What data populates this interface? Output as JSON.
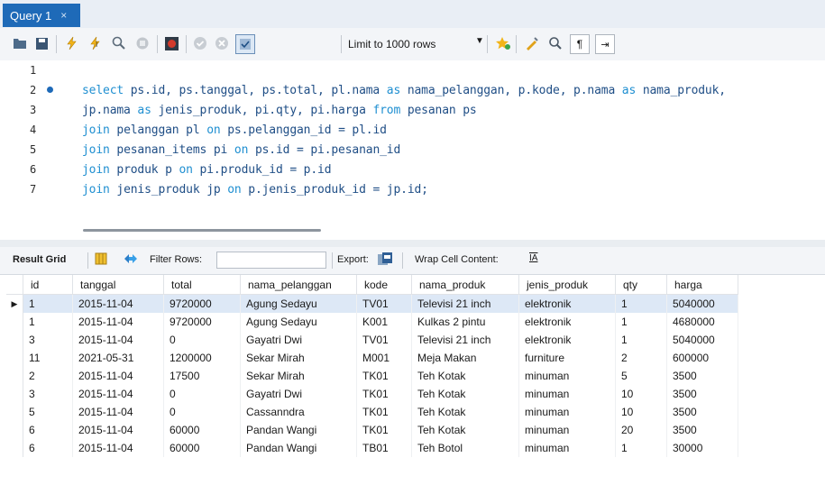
{
  "tab": {
    "label": "Query 1",
    "close": "×"
  },
  "toolbar": {
    "limit_label": "Limit to 1000 rows",
    "icons": [
      "folder-open-icon",
      "save-icon",
      "execute-icon",
      "execute-current-icon",
      "explain-icon",
      "stop-icon",
      "toggle-error-icon",
      "commit-icon",
      "rollback-icon",
      "autocommit-icon",
      "limit-dropdown",
      "bookmark-star-icon",
      "beautify-icon",
      "find-icon",
      "invisible-chars-icon",
      "wrap-icon"
    ]
  },
  "editor": {
    "lines": [
      {
        "n": "1",
        "parts": []
      },
      {
        "n": "2",
        "parts": [
          [
            "kw",
            "select"
          ],
          [
            "t",
            " ps.id, ps.tanggal, ps.total, pl.nama "
          ],
          [
            "kw",
            "as"
          ],
          [
            "t",
            " nama_pelanggan, p.kode, p.nama "
          ],
          [
            "kw",
            "as"
          ],
          [
            "t",
            " nama_produk,"
          ]
        ]
      },
      {
        "n": "3",
        "parts": [
          [
            "t",
            "jp.nama "
          ],
          [
            "kw",
            "as"
          ],
          [
            "t",
            " jenis_produk, pi.qty, pi.harga "
          ],
          [
            "kw",
            "from"
          ],
          [
            "t",
            " pesanan ps"
          ]
        ]
      },
      {
        "n": "4",
        "parts": [
          [
            "kw",
            "join"
          ],
          [
            "t",
            " pelanggan pl "
          ],
          [
            "kw",
            "on"
          ],
          [
            "t",
            " ps.pelanggan_id = pl.id"
          ]
        ]
      },
      {
        "n": "5",
        "parts": [
          [
            "kw",
            "join"
          ],
          [
            "t",
            " pesanan_items pi "
          ],
          [
            "kw",
            "on"
          ],
          [
            "t",
            " ps.id = pi.pesanan_id"
          ]
        ]
      },
      {
        "n": "6",
        "parts": [
          [
            "kw",
            "join"
          ],
          [
            "t",
            " produk p "
          ],
          [
            "kw",
            "on"
          ],
          [
            "t",
            " pi.produk_id = p.id"
          ]
        ]
      },
      {
        "n": "7",
        "parts": [
          [
            "kw",
            "join"
          ],
          [
            "t",
            " jenis_produk jp "
          ],
          [
            "kw",
            "on"
          ],
          [
            "t",
            " p.jenis_produk_id = jp.id;"
          ]
        ]
      }
    ]
  },
  "result_bar": {
    "result_grid": "Result Grid",
    "filter_rows": "Filter Rows:",
    "filter_value": "",
    "export": "Export:",
    "wrap": "Wrap Cell Content:"
  },
  "grid": {
    "columns": [
      "id",
      "tanggal",
      "total",
      "nama_pelanggan",
      "kode",
      "nama_produk",
      "jenis_produk",
      "qty",
      "harga"
    ],
    "rows": [
      [
        "1",
        "2015-11-04",
        "9720000",
        "Agung Sedayu",
        "TV01",
        "Televisi 21 inch",
        "elektronik",
        "1",
        "5040000"
      ],
      [
        "1",
        "2015-11-04",
        "9720000",
        "Agung Sedayu",
        "K001",
        "Kulkas 2 pintu",
        "elektronik",
        "1",
        "4680000"
      ],
      [
        "3",
        "2015-11-04",
        "0",
        "Gayatri Dwi",
        "TV01",
        "Televisi 21 inch",
        "elektronik",
        "1",
        "5040000"
      ],
      [
        "11",
        "2021-05-31",
        "1200000",
        "Sekar Mirah",
        "M001",
        "Meja Makan",
        "furniture",
        "2",
        "600000"
      ],
      [
        "2",
        "2015-11-04",
        "17500",
        "Sekar Mirah",
        "TK01",
        "Teh Kotak",
        "minuman",
        "5",
        "3500"
      ],
      [
        "3",
        "2015-11-04",
        "0",
        "Gayatri Dwi",
        "TK01",
        "Teh Kotak",
        "minuman",
        "10",
        "3500"
      ],
      [
        "5",
        "2015-11-04",
        "0",
        "Cassanndra",
        "TK01",
        "Teh Kotak",
        "minuman",
        "10",
        "3500"
      ],
      [
        "6",
        "2015-11-04",
        "60000",
        "Pandan Wangi",
        "TK01",
        "Teh Kotak",
        "minuman",
        "20",
        "3500"
      ],
      [
        "6",
        "2015-11-04",
        "60000",
        "Pandan Wangi",
        "TB01",
        "Teh Botol",
        "minuman",
        "1",
        "30000"
      ]
    ],
    "selected_row": 0,
    "row_indicator": "▶"
  },
  "colors": {
    "accent": "#1e6ab8",
    "keyword": "#1f8fd1",
    "code": "#1f4e86",
    "selection": "#dde8f6"
  }
}
